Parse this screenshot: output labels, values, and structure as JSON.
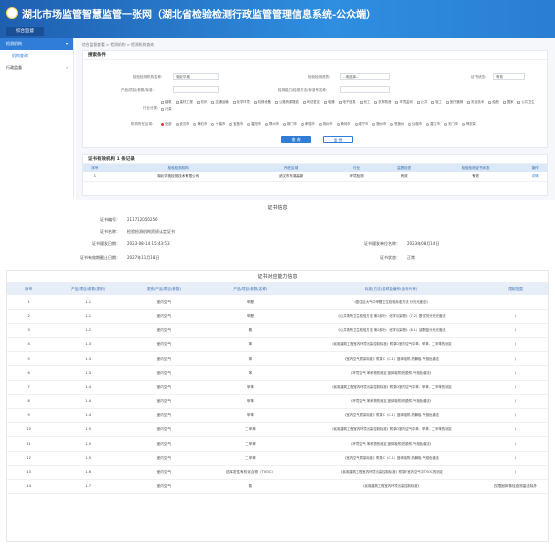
{
  "header": {
    "title": "湖北市场监管智慧监管一张网（湖北省检验检测行政监管管理信息系统-公众端）",
    "tab": "综合监督"
  },
  "sidebar": {
    "items": [
      {
        "label": "检测机构",
        "active": true
      },
      {
        "label": "机构查询",
        "sub": true
      },
      {
        "label": "行政监督",
        "active": false
      }
    ]
  },
  "breadcrumb": "综合监督查看 > 检测机构 > 检测机构查询",
  "search": {
    "title": "搜索条件",
    "fields": [
      {
        "label": "检验检测机构名称：",
        "value": "湖北华奥"
      },
      {
        "label": "检验检测资质：",
        "value": "--请选择--"
      },
      {
        "label": "证书状态：",
        "value": "有效"
      },
      {
        "label": "产品/项目/参数/标准：",
        "value": ""
      },
      {
        "label": "检测能力/检测方法/标准号名称：",
        "value": ""
      }
    ],
    "domain_label": "行业分类：",
    "domains": [
      "建筑",
      "建材工程",
      "纺织",
      "交通运输",
      "化学环境",
      "机械设备",
      "公路桥梁隧道",
      "司法鉴定",
      "电器",
      "电子信息",
      "化工",
      "农林牧渔",
      "环境监测",
      "公共",
      "轻工",
      "医疗器械",
      "安全技术",
      "船舶",
      "国家",
      "公共卫生",
      "计量"
    ],
    "area_label": "机构所在区域：",
    "areas": [
      "全部",
      "武汉市",
      "黄石市",
      "十堰市",
      "宜昌市",
      "襄阳市",
      "鄂州市",
      "荆门市",
      "孝感市",
      "荆州市",
      "黄冈市",
      "咸宁市",
      "随州市",
      "恩施州",
      "仙桃市",
      "潜江市",
      "天门市",
      "神农架"
    ],
    "query_label": "查 询",
    "reset_label": "重 置"
  },
  "result": {
    "title": "证书有效机构 1 条记录",
    "headers": [
      "序号",
      "检验检测机构",
      "所在区域",
      "行业",
      "监督检查",
      "检验检测证书状态",
      "操作"
    ],
    "rows": [
      [
        "1",
        "湖北华奥检测技术有限公司",
        "武汉市东湖高新",
        "环境检测",
        "有效",
        "有效",
        "详情"
      ]
    ]
  },
  "cert": {
    "title": "证书信息",
    "rows": [
      {
        "l": "证书编号：",
        "v": "211712050256"
      },
      {
        "l": "证书名称：",
        "v": "检验检测机构资质认定证书"
      }
    ],
    "left": [
      {
        "l": "证书颁发日期：",
        "v": "2023-08-14 15:43:53"
      },
      {
        "l": "证书有效期截止日期：",
        "v": "2027年11月18日"
      }
    ],
    "right": [
      {
        "l": "证书颁发单位名称：",
        "v": "2023年08月14日"
      },
      {
        "l": "证书状态：",
        "v": "正常"
      }
    ]
  },
  "ability": {
    "title": "证书对应能力信息",
    "headers": [
      "序号",
      "产品/项目/参数(类别)",
      "类别/产品/项目(参数)",
      "产品/项目/参数(名称)",
      "标准(方法)名称及编号(含年代号)",
      "限制范围"
    ],
    "rows": [
      [
        "1",
        "1.1",
        "室内空气",
        "甲醛",
        "《居住区大气中甲醛卫生检验标准方法 分光光度法》",
        ""
      ],
      [
        "2",
        "1.1",
        "室内空气",
        "甲醛",
        "《公共场所卫生检验方法 第2部分：化学污染物》（7.2）酚试剂分光光度法",
        "/"
      ],
      [
        "3",
        "1.2",
        "室内空气",
        "氨",
        "《公共场所卫生检验方法 第2部分：化学污染物》（8.1）靛酚蓝分光光度法",
        "/"
      ],
      [
        "4",
        "1.3",
        "室内空气",
        "苯",
        "《民用建筑工程室内环境污染控制标准》附录D室内空气中苯、甲苯、二甲苯的测定",
        "/"
      ],
      [
        "5",
        "1.3",
        "室内空气",
        "苯",
        "《室内空气质量标准》附录C（C.1）固体吸附-热解吸-气相色谱法",
        "/"
      ],
      [
        "6",
        "1.3",
        "室内空气",
        "苯",
        "《环境空气 苯系物的测定 固体吸附/热脱附-气相色谱法》",
        "/"
      ],
      [
        "7",
        "1.4",
        "室内空气",
        "甲苯",
        "《民用建筑工程室内环境污染控制标准》附录D室内空气中苯、甲苯、二甲苯的测定",
        "/"
      ],
      [
        "8",
        "1.4",
        "室内空气",
        "甲苯",
        "《环境空气 苯系物的测定 固体吸附/热脱附-气相色谱法》",
        "/"
      ],
      [
        "9",
        "1.4",
        "室内空气",
        "甲苯",
        "《室内空气质量标准》附录C（C.1）固体吸附-热解吸-气相色谱法",
        "/"
      ],
      [
        "10",
        "1.5",
        "室内空气",
        "二甲苯",
        "《民用建筑工程室内环境污染控制标准》附录D室内空气中苯、甲苯、二甲苯的测定",
        "/"
      ],
      [
        "11",
        "1.5",
        "室内空气",
        "二甲苯",
        "《环境空气 苯系物的测定 固体吸附/热脱附-气相色谱法》",
        "/"
      ],
      [
        "12",
        "1.5",
        "室内空气",
        "二甲苯",
        "《室内空气质量标准》附录C（C.1）固体吸附-热解吸-气相色谱法",
        "/"
      ],
      [
        "13",
        "1.6",
        "室内空气",
        "总挥发性有机化合物（TVOC）",
        "《民用建筑工程室内环境污染控制标准》附录E室内空气中TVOC的测定",
        "/"
      ],
      [
        "14",
        "1.7",
        "室内空气",
        "氡",
        "《民用建筑工程室内环境污染控制标准》",
        "仅限固体核径迹测量法除外"
      ]
    ]
  }
}
